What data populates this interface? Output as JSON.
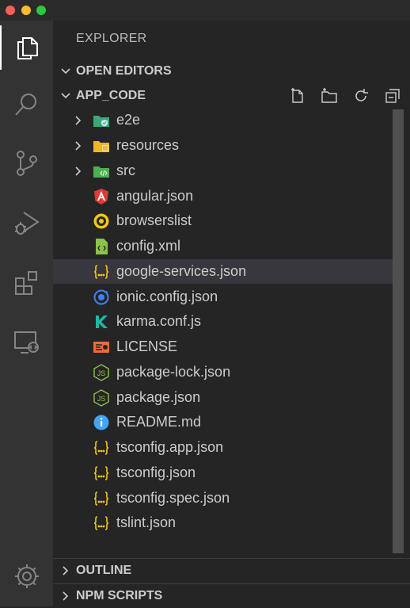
{
  "window": {
    "buttons": [
      "close",
      "minimize",
      "zoom"
    ]
  },
  "activity_bar": {
    "items": [
      {
        "name": "explorer",
        "icon": "files-icon",
        "active": true
      },
      {
        "name": "search",
        "icon": "search-icon",
        "active": false
      },
      {
        "name": "source-control",
        "icon": "source-control-icon",
        "active": false
      },
      {
        "name": "run-debug",
        "icon": "run-debug-icon",
        "active": false
      },
      {
        "name": "extensions",
        "icon": "extensions-icon",
        "active": false
      },
      {
        "name": "remote-explorer",
        "icon": "remote-explorer-icon",
        "active": false
      },
      {
        "name": "manage",
        "icon": "gear-icon",
        "active": false
      }
    ]
  },
  "sidebar": {
    "title": "EXPLORER",
    "open_editors": {
      "label": "OPEN EDITORS",
      "expanded": true
    },
    "workspace": {
      "label": "APP_CODE",
      "expanded": true,
      "actions": [
        "new-file-icon",
        "new-folder-icon",
        "refresh-icon",
        "collapse-all-icon"
      ],
      "items": [
        {
          "label": "e2e",
          "kind": "folder",
          "icon": "folder-e2e-icon",
          "color": "#3aa876"
        },
        {
          "label": "resources",
          "kind": "folder",
          "icon": "folder-resources-icon",
          "color": "#f0b528"
        },
        {
          "label": "src",
          "kind": "folder",
          "icon": "folder-src-icon",
          "color": "#4caf50"
        },
        {
          "label": "angular.json",
          "kind": "file",
          "icon": "angular-icon",
          "color": "#dd3b38"
        },
        {
          "label": "browserslist",
          "kind": "file",
          "icon": "browserslist-icon",
          "color": "#f5c518"
        },
        {
          "label": "config.xml",
          "kind": "file",
          "icon": "xml-icon",
          "color": "#8bc34a"
        },
        {
          "label": "google-services.json",
          "kind": "file",
          "icon": "json-icon",
          "color": "#f5c518",
          "selected": true
        },
        {
          "label": "ionic.config.json",
          "kind": "file",
          "icon": "ionic-icon",
          "color": "#3b82f6"
        },
        {
          "label": "karma.conf.js",
          "kind": "file",
          "icon": "karma-icon",
          "color": "#23b5a5"
        },
        {
          "label": "LICENSE",
          "kind": "file",
          "icon": "license-icon",
          "color": "#ef6a3c"
        },
        {
          "label": "package-lock.json",
          "kind": "file",
          "icon": "nodejs-icon",
          "color": "#8bc34a"
        },
        {
          "label": "package.json",
          "kind": "file",
          "icon": "nodejs-icon",
          "color": "#8bc34a"
        },
        {
          "label": "README.md",
          "kind": "file",
          "icon": "info-icon",
          "color": "#42a5f5"
        },
        {
          "label": "tsconfig.app.json",
          "kind": "file",
          "icon": "json-icon",
          "color": "#f5c518"
        },
        {
          "label": "tsconfig.json",
          "kind": "file",
          "icon": "json-icon",
          "color": "#f5c518"
        },
        {
          "label": "tsconfig.spec.json",
          "kind": "file",
          "icon": "json-icon",
          "color": "#f5c518"
        },
        {
          "label": "tslint.json",
          "kind": "file",
          "icon": "json-icon",
          "color": "#f5c518"
        }
      ]
    },
    "outline": {
      "label": "OUTLINE",
      "expanded": false
    },
    "npm_scripts": {
      "label": "NPM SCRIPTS",
      "expanded": false
    }
  }
}
